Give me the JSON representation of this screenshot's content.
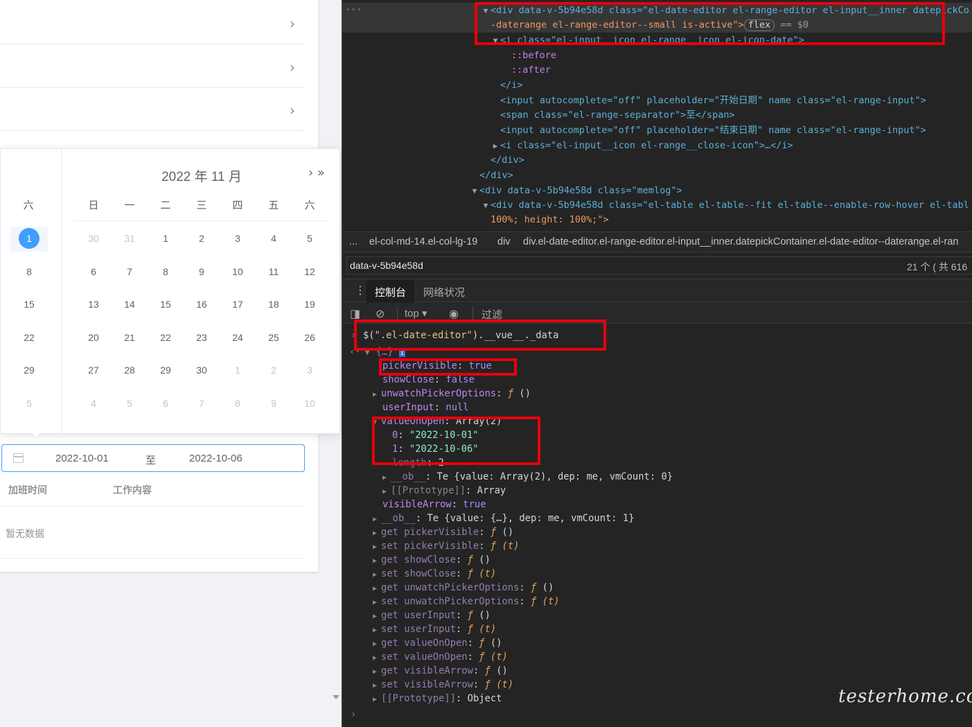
{
  "app": {
    "calendar": {
      "title": "2022 年 11 月",
      "nav_next": "› »",
      "left_month": {
        "weekday_header": "六",
        "days": [
          "1",
          "8",
          "15",
          "22",
          "29",
          "5"
        ]
      },
      "weekday_headers": [
        "日",
        "一",
        "二",
        "三",
        "四",
        "五",
        "六"
      ],
      "weeks": [
        [
          "30",
          "31",
          "1",
          "2",
          "3",
          "4",
          "5"
        ],
        [
          "6",
          "7",
          "8",
          "9",
          "10",
          "11",
          "12"
        ],
        [
          "13",
          "14",
          "15",
          "16",
          "17",
          "18",
          "19"
        ],
        [
          "20",
          "21",
          "22",
          "23",
          "24",
          "25",
          "26"
        ],
        [
          "27",
          "28",
          "29",
          "30",
          "1",
          "2",
          "3"
        ],
        [
          "4",
          "5",
          "6",
          "7",
          "8",
          "9",
          "10"
        ]
      ]
    },
    "range_picker": {
      "start": "2022-10-01",
      "separator": "至",
      "end": "2022-10-06"
    },
    "table": {
      "columns": [
        "加班时间",
        "工作内容"
      ],
      "empty_text": "暂无数据"
    }
  },
  "devtools": {
    "elements": {
      "line1": "<div data-v-5b94e58d class=\"el-date-editor el-range-editor el-input__inner datepickCo",
      "line2_a": "-daterange el-range-editor--small is-active\">",
      "line2_badge": "flex",
      "line2_b": " == $0",
      "line3": "<i class=\"el-input__icon el-range__icon el-icon-date\">",
      "line4": "::before",
      "line5": "::after",
      "line6": "</i>",
      "line7_a": "<input autocomplete=\"off\" placeholder=\"开始日期\" name class=\"el-range-input\">",
      "line8": "<span class=\"el-range-separator\">至</span>",
      "line9": "<input autocomplete=\"off\" placeholder=\"结束日期\" name class=\"el-range-input\">",
      "line10": "<i class=\"el-input__icon el-range__close-icon\">…</i>",
      "line11": "</div>",
      "line12": "</div>",
      "line13": "<div data-v-5b94e58d class=\"memlog\">",
      "line14": "<div data-v-5b94e58d class=\"el-table el-table--fit el-table--enable-row-hover el-tabl",
      "line15": "100%; height: 100%;\">"
    },
    "breadcrumb": {
      "dots": "...",
      "item1": "el-col-md-14.el-col-lg-19",
      "item2": "div",
      "item3": "div.el-date-editor.el-range-editor.el-input__inner.datepickContainer.el-date-editor--daterange.el-ran"
    },
    "search": {
      "query": "data-v-5b94e58d",
      "count": "21 个 ( 共 616"
    },
    "tabs": [
      "控制台",
      "网络状况"
    ],
    "toolbar": {
      "context": "top",
      "filter_placeholder": "过滤"
    },
    "console": {
      "command": "$(\".el-date-editor\").__vue__._data",
      "lines": [
        "{…}",
        "pickerVisible: true",
        "showClose: false",
        "unwatchPickerOptions: ƒ ()",
        "userInput: null",
        "valueOnOpen: Array(2)",
        "0: \"2022-10-01\"",
        "1: \"2022-10-06\"",
        "length: 2",
        "__ob__: Te {value: Array(2), dep: me, vmCount: 0}",
        "[[Prototype]]: Array",
        "visibleArrow: true",
        "__ob__: Te {value: {…}, dep: me, vmCount: 1}",
        "get pickerVisible: ƒ ()",
        "set pickerVisible: ƒ (t)",
        "get showClose: ƒ ()",
        "set showClose: ƒ (t)",
        "get unwatchPickerOptions: ƒ ()",
        "set unwatchPickerOptions: ƒ (t)",
        "get userInput: ƒ ()",
        "set userInput: ƒ (t)",
        "get valueOnOpen: ƒ ()",
        "set valueOnOpen: ƒ (t)",
        "get visibleArrow: ƒ ()",
        "set visibleArrow: ƒ (t)",
        "[[Prototype]]: Object"
      ]
    },
    "watermark": "testerhome.com",
    "colors": {
      "highlight": "#e8000c",
      "accent": "#409eff"
    }
  }
}
